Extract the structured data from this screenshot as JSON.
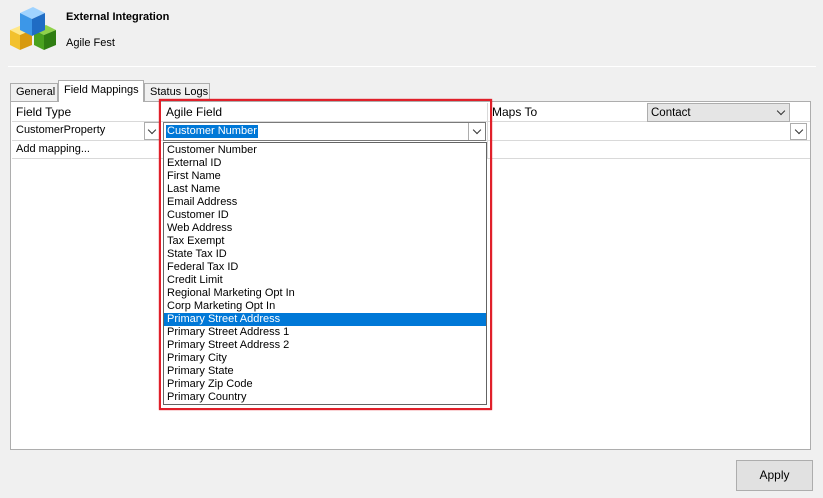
{
  "header": {
    "title": "External Integration",
    "subtitle": "Agile Fest"
  },
  "tabs": [
    {
      "label": "General"
    },
    {
      "label": "Field Mappings"
    },
    {
      "label": "Status Logs"
    }
  ],
  "grid": {
    "headers": {
      "field_type": "Field Type",
      "agile_field": "Agile Field",
      "maps_to": "Maps To"
    },
    "maps_to_target": "Contact",
    "row": {
      "field_type": "CustomerProperty",
      "agile_field": "Customer Number"
    },
    "add_mapping": "Add mapping..."
  },
  "dropdown": {
    "selected_index": 13,
    "options": [
      "Customer Number",
      "External ID",
      "First Name",
      "Last Name",
      "Email Address",
      "Customer ID",
      "Web Address",
      "Tax Exempt",
      "State Tax ID",
      "Federal Tax ID",
      "Credit Limit",
      "Regional Marketing Opt In",
      "Corp Marketing Opt In",
      "Primary Street Address",
      "Primary Street Address 1",
      "Primary Street Address 2",
      "Primary City",
      "Primary State",
      "Primary Zip Code",
      "Primary Country"
    ]
  },
  "footer": {
    "apply_label": "Apply"
  },
  "colors": {
    "highlight": "#e0202a",
    "selection": "#0078d7"
  }
}
